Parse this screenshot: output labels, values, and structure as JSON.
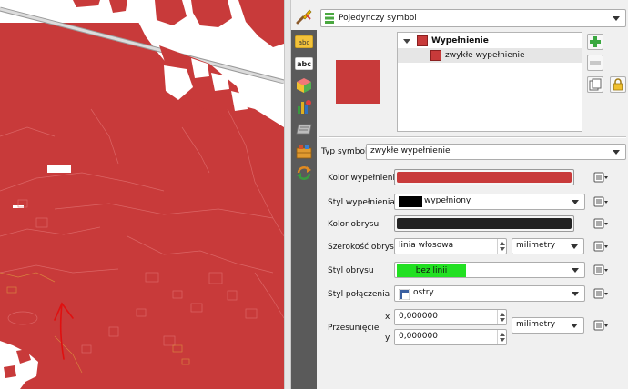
{
  "colors": {
    "fill": "#c83a3a",
    "outline": "#222222",
    "highlight": "#22e022",
    "sidebar": "#5a5a5a"
  },
  "icons": {
    "renderer": "rule-list-icon",
    "sidebar": [
      "label-icon",
      "abc-label-icon",
      "3d-box-icon",
      "diagram-icon",
      "metadata-icon",
      "fields-icon",
      "actions-icon"
    ]
  },
  "renderer": {
    "selected": "Pojedynczy symbol"
  },
  "tree": {
    "items": [
      {
        "label": "Wypełnienie",
        "bold": true
      },
      {
        "label": "zwykłe wypełnienie",
        "bold": false
      }
    ]
  },
  "form": {
    "symbol_type_label": "Typ symbolu",
    "symbol_type_value": "zwykłe wypełnienie",
    "fill_color_label": "Kolor wypełnienia",
    "fill_style_label": "Styl wypełnienia",
    "fill_style_value": "wypełniony",
    "outline_color_label": "Kolor obrysu",
    "outline_width_label": "Szerokość obrysu",
    "outline_width_value": "linia włosowa",
    "outline_width_unit": "milimetry",
    "outline_style_label": "Styl obrysu",
    "outline_style_value": "bez linii",
    "join_style_label": "Styl połączenia",
    "join_style_value": "ostry",
    "offset_label": "Przesunięcie",
    "offset_x_label": "x",
    "offset_x_value": "0,000000",
    "offset_y_label": "y",
    "offset_y_value": "0,000000",
    "offset_unit": "milimetry"
  }
}
